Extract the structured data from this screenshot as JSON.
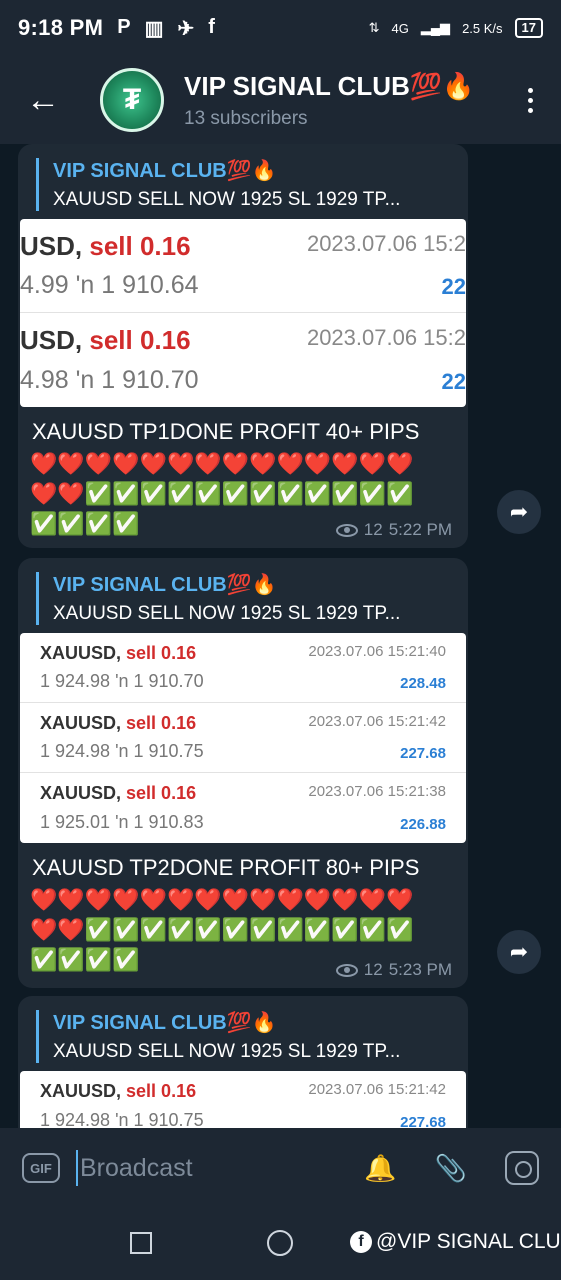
{
  "status": {
    "time": "9:18 PM",
    "left_icons": [
      "P",
      "▥",
      "✈",
      "f"
    ],
    "network": "4G",
    "speed": "2.5 K/s",
    "battery": "17"
  },
  "header": {
    "title": "VIP SIGNAL CLUB💯🔥",
    "subscribers": "13 subscribers",
    "avatar_letter": "₮"
  },
  "messages": [
    {
      "reply_title": "VIP SIGNAL CLUB💯🔥",
      "reply_text": "XAUUSD SELL NOW 1925    SL 1929  TP...",
      "trades": [
        {
          "symbol": "USD,",
          "side": "sell 0.16",
          "prices": "4.99 'n  1 910.64",
          "date": "2023.07.06 15:2",
          "profit": "22"
        },
        {
          "symbol": "USD,",
          "side": "sell 0.16",
          "prices": "4.98 'n  1 910.70",
          "date": "2023.07.06 15:2",
          "profit": "22"
        }
      ],
      "text": "XAUUSD TP1DONE PROFIT 40+ PIPS",
      "emoji_rows": [
        "❤️❤️❤️❤️❤️❤️❤️❤️❤️❤️❤️❤️❤️❤️",
        "❤️❤️✅✅✅✅✅✅✅✅✅✅✅✅",
        "✅✅✅✅"
      ],
      "views": "12",
      "time": "5:22 PM"
    },
    {
      "reply_title": "VIP SIGNAL CLUB💯🔥",
      "reply_text": "XAUUSD SELL NOW 1925    SL 1929  TP...",
      "trades": [
        {
          "symbol": "XAUUSD,",
          "side": "sell 0.16",
          "prices": "1 924.98 'n  1 910.70",
          "date": "2023.07.06 15:21:40",
          "profit": "228.48"
        },
        {
          "symbol": "XAUUSD,",
          "side": "sell 0.16",
          "prices": "1 924.98 'n  1 910.75",
          "date": "2023.07.06 15:21:42",
          "profit": "227.68"
        },
        {
          "symbol": "XAUUSD,",
          "side": "sell 0.16",
          "prices": "1 925.01 'n  1 910.83",
          "date": "2023.07.06 15:21:38",
          "profit": "226.88"
        }
      ],
      "text": "XAUUSD TP2DONE PROFIT 80+ PIPS",
      "emoji_rows": [
        "❤️❤️❤️❤️❤️❤️❤️❤️❤️❤️❤️❤️❤️❤️",
        "❤️❤️✅✅✅✅✅✅✅✅✅✅✅✅",
        "✅✅✅✅"
      ],
      "views": "12",
      "time": "5:23 PM"
    },
    {
      "reply_title": "VIP SIGNAL CLUB💯🔥",
      "reply_text": "XAUUSD SELL NOW 1925    SL 1929  TP...",
      "trades": [
        {
          "symbol": "XAUUSD,",
          "side": "sell 0.16",
          "prices": "1 924.98 'n  1 910.75",
          "date": "2023.07.06 15:21:42",
          "profit": "227.68"
        }
      ]
    }
  ],
  "input": {
    "gif": "GIF",
    "placeholder": "Broadcast"
  },
  "watermark": "@VIP SIGNAL CLUB"
}
